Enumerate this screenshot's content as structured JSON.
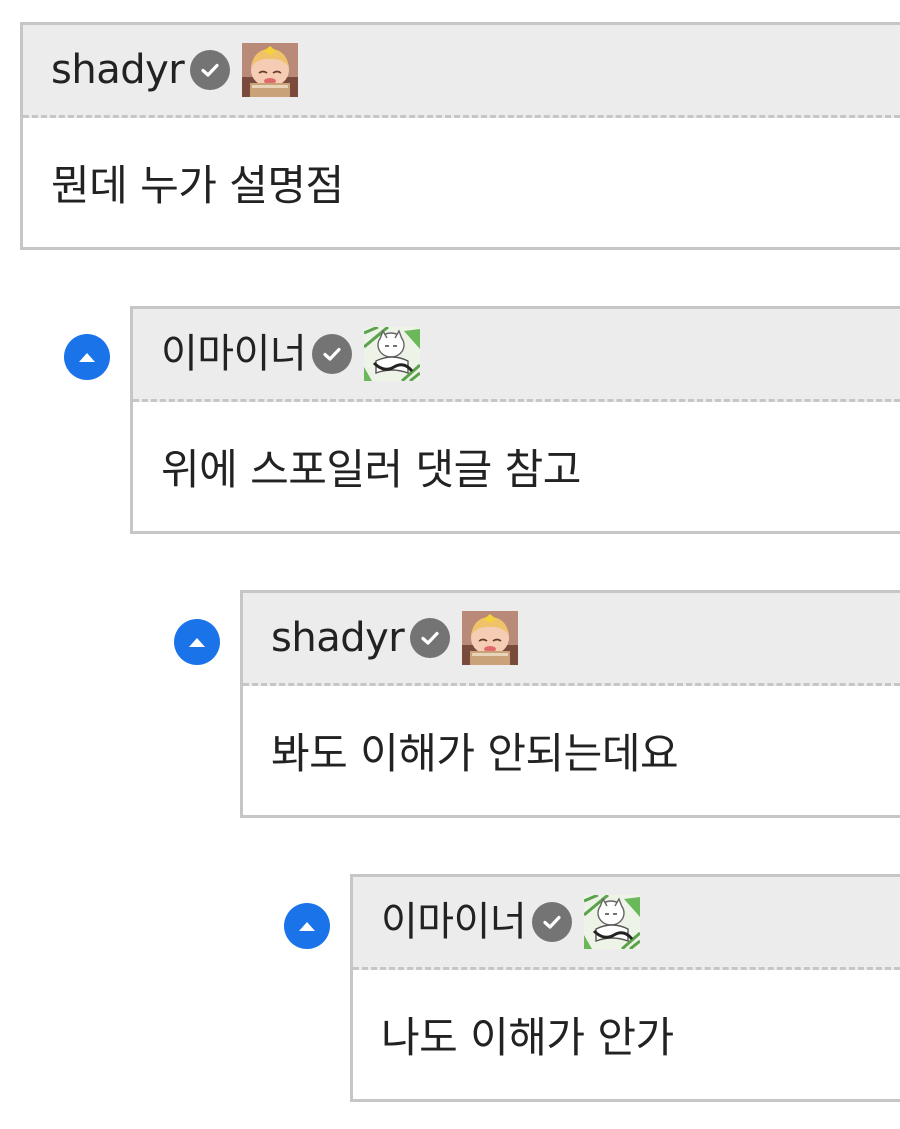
{
  "comments": [
    {
      "username": "shadyr",
      "verified_icon": "verified-check-icon",
      "avatar": "anime-girl-avatar",
      "text": "뭔데 누가 설명점",
      "depth": 0,
      "reply_icon": null
    },
    {
      "username": "이마이너",
      "verified_icon": "verified-check-icon",
      "avatar": "sketch-character-avatar",
      "text": "위에 스포일러 댓글 참고",
      "depth": 1,
      "reply_icon": "reply-up-arrow-icon"
    },
    {
      "username": "shadyr",
      "verified_icon": "verified-check-icon",
      "avatar": "anime-girl-avatar",
      "text": "봐도 이해가 안되는데요",
      "depth": 2,
      "reply_icon": "reply-up-arrow-icon"
    },
    {
      "username": "이마이너",
      "verified_icon": "verified-check-icon",
      "avatar": "sketch-character-avatar",
      "text": "나도 이해가 안가",
      "depth": 3,
      "reply_icon": "reply-up-arrow-icon"
    }
  ],
  "colors": {
    "header_bg": "#ececec",
    "border": "#c6c6c6",
    "verified_badge": "#747474",
    "reply_arrow": "#1a73e8",
    "text": "#222222"
  }
}
